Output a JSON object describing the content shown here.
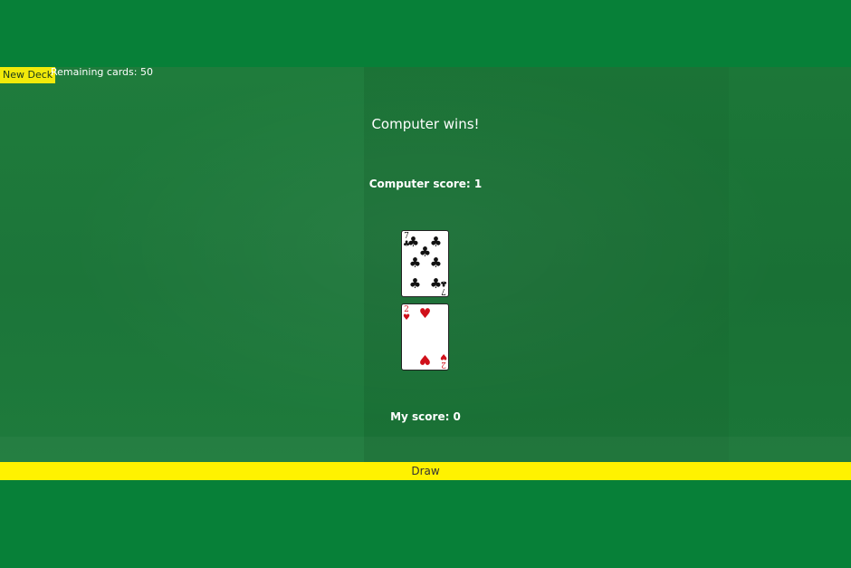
{
  "toolbar": {
    "new_deck_label": "New Deck",
    "remaining_text": "Remaining cards: 50"
  },
  "game": {
    "result_text": "Computer wins!",
    "computer_score_text": "Computer score: 1",
    "my_score_text": "My score: 0"
  },
  "cards": {
    "computer": {
      "rank": "7",
      "suit": "clubs",
      "suit_symbol": "♣",
      "color": "#111111"
    },
    "player": {
      "rank": "2",
      "suit": "hearts",
      "suit_symbol": "♥",
      "color": "#d0101a"
    }
  },
  "actions": {
    "draw_label": "Draw"
  },
  "colors": {
    "table_green": "#078038",
    "felt_green": "#1a7437",
    "button_yellow": "#fff200"
  }
}
